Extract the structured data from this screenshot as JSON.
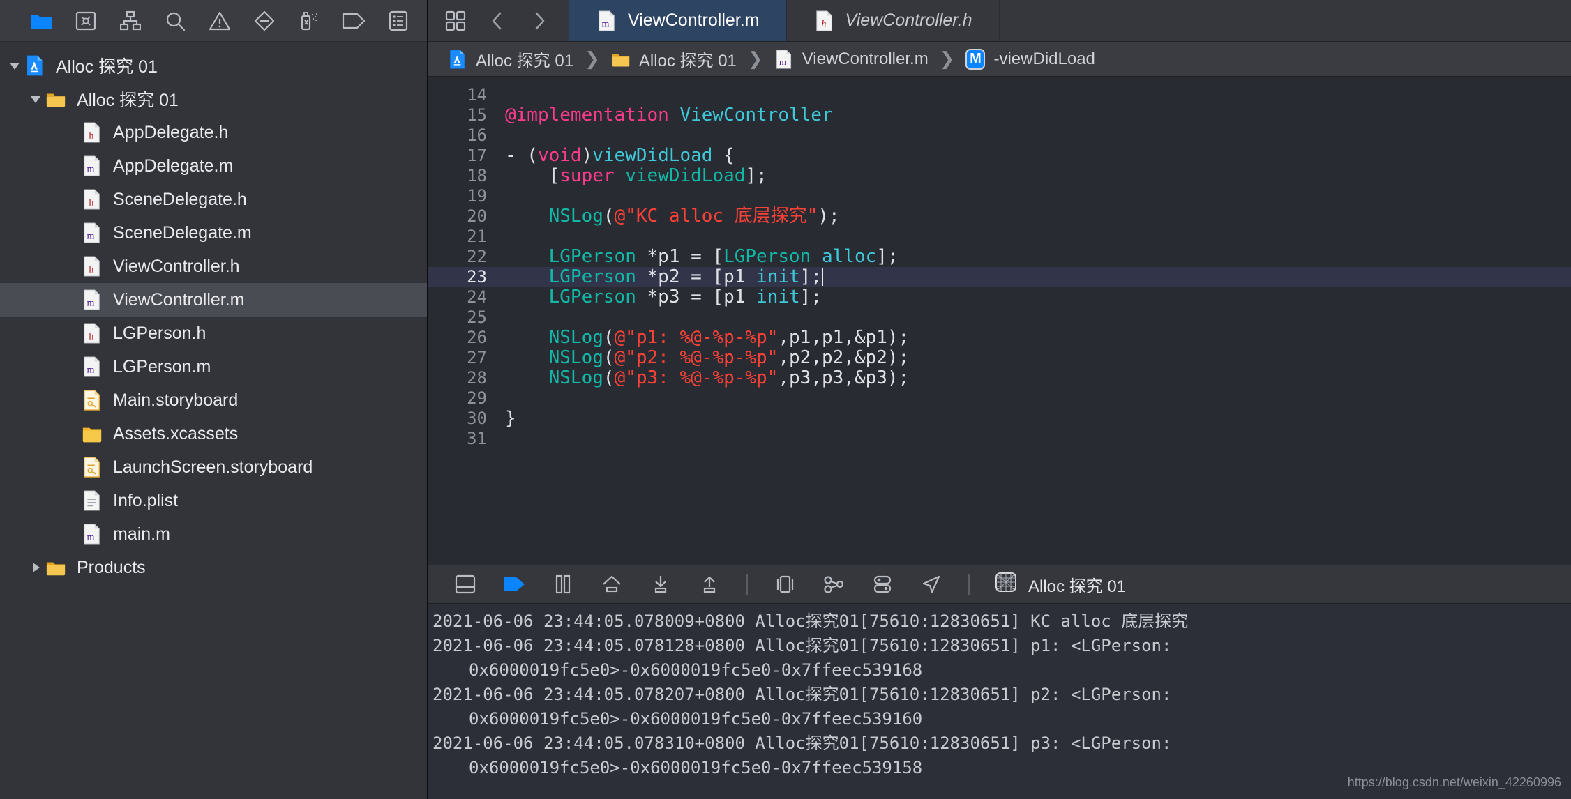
{
  "navigator": {
    "toolbar_icons": [
      {
        "name": "folder-icon",
        "label": "Project navigator"
      },
      {
        "name": "source-control-icon",
        "label": "Source control navigator"
      },
      {
        "name": "symbol-hierarchy-icon",
        "label": "Symbol navigator"
      },
      {
        "name": "search-icon",
        "label": "Find navigator"
      },
      {
        "name": "warning-triangle-icon",
        "label": "Issue navigator"
      },
      {
        "name": "test-diamond-icon",
        "label": "Test navigator"
      },
      {
        "name": "debug-spray-icon",
        "label": "Debug navigator"
      },
      {
        "name": "tag-icon",
        "label": "Breakpoint navigator"
      },
      {
        "name": "report-list-icon",
        "label": "Report navigator"
      }
    ],
    "tree": [
      {
        "label": "Alloc 探究 01",
        "icon": "xcode-project-icon",
        "depth": 0,
        "twisty": "open",
        "selected": false
      },
      {
        "label": "Alloc 探究 01",
        "icon": "folder-icon",
        "depth": 1,
        "twisty": "open",
        "selected": false
      },
      {
        "label": "AppDelegate.h",
        "icon": "header-file-icon",
        "depth": 2,
        "twisty": "none",
        "selected": false
      },
      {
        "label": "AppDelegate.m",
        "icon": "objc-file-icon",
        "depth": 2,
        "twisty": "none",
        "selected": false
      },
      {
        "label": "SceneDelegate.h",
        "icon": "header-file-icon",
        "depth": 2,
        "twisty": "none",
        "selected": false
      },
      {
        "label": "SceneDelegate.m",
        "icon": "objc-file-icon",
        "depth": 2,
        "twisty": "none",
        "selected": false
      },
      {
        "label": "ViewController.h",
        "icon": "header-file-icon",
        "depth": 2,
        "twisty": "none",
        "selected": false
      },
      {
        "label": "ViewController.m",
        "icon": "objc-file-icon",
        "depth": 2,
        "twisty": "none",
        "selected": true
      },
      {
        "label": "LGPerson.h",
        "icon": "header-file-icon",
        "depth": 2,
        "twisty": "none",
        "selected": false
      },
      {
        "label": "LGPerson.m",
        "icon": "objc-file-icon",
        "depth": 2,
        "twisty": "none",
        "selected": false
      },
      {
        "label": "Main.storyboard",
        "icon": "storyboard-file-icon",
        "depth": 2,
        "twisty": "none",
        "selected": false
      },
      {
        "label": "Assets.xcassets",
        "icon": "assets-catalog-icon",
        "depth": 2,
        "twisty": "none",
        "selected": false
      },
      {
        "label": "LaunchScreen.storyboard",
        "icon": "storyboard-file-icon",
        "depth": 2,
        "twisty": "none",
        "selected": false
      },
      {
        "label": "Info.plist",
        "icon": "plist-file-icon",
        "depth": 2,
        "twisty": "none",
        "selected": false
      },
      {
        "label": "main.m",
        "icon": "objc-file-icon",
        "depth": 2,
        "twisty": "none",
        "selected": false
      },
      {
        "label": "Products",
        "icon": "folder-icon",
        "depth": 1,
        "twisty": "closed",
        "selected": false
      }
    ]
  },
  "tabbar": {
    "grid_button": "editor-options-icon",
    "back_button": "chevron-left-icon",
    "forward_button": "chevron-right-icon",
    "tabs": [
      {
        "label": "ViewController.m",
        "icon": "objc-file-icon",
        "active": true,
        "italic": false
      },
      {
        "label": "ViewController.h",
        "icon": "header-file-icon",
        "active": false,
        "italic": true
      }
    ]
  },
  "breadcrumb": {
    "items": [
      {
        "label": "Alloc 探究 01",
        "icon": "xcode-project-icon"
      },
      {
        "label": "Alloc 探究 01",
        "icon": "folder-icon"
      },
      {
        "label": "ViewController.m",
        "icon": "objc-file-icon"
      },
      {
        "label": "-viewDidLoad",
        "icon": "method-badge-m"
      }
    ],
    "separator": "❯"
  },
  "editor": {
    "first_line_number": 14,
    "current_line": 23,
    "lines": [
      {
        "n": 14,
        "tokens": []
      },
      {
        "n": 15,
        "tokens": [
          {
            "t": "@implementation ",
            "c": "k"
          },
          {
            "t": "ViewController",
            "c": "t"
          }
        ]
      },
      {
        "n": 16,
        "tokens": []
      },
      {
        "n": 17,
        "tokens": [
          {
            "t": "- (",
            "c": "p"
          },
          {
            "t": "void",
            "c": "k"
          },
          {
            "t": ")",
            "c": "p"
          },
          {
            "t": "viewDidLoad",
            "c": "t"
          },
          {
            "t": " {",
            "c": "p"
          }
        ]
      },
      {
        "n": 18,
        "tokens": [
          {
            "t": "    [",
            "c": "p"
          },
          {
            "t": "super",
            "c": "k"
          },
          {
            "t": " ",
            "c": "p"
          },
          {
            "t": "viewDidLoad",
            "c": "cls"
          },
          {
            "t": "];",
            "c": "p"
          }
        ]
      },
      {
        "n": 19,
        "tokens": []
      },
      {
        "n": 20,
        "tokens": [
          {
            "t": "    ",
            "c": "p"
          },
          {
            "t": "NSLog",
            "c": "cls"
          },
          {
            "t": "(",
            "c": "p"
          },
          {
            "t": "@\"KC alloc 底层探究\"",
            "c": "s"
          },
          {
            "t": ");",
            "c": "p"
          }
        ]
      },
      {
        "n": 21,
        "tokens": []
      },
      {
        "n": 22,
        "tokens": [
          {
            "t": "    ",
            "c": "p"
          },
          {
            "t": "LGPerson",
            "c": "cls"
          },
          {
            "t": " *p1 = [",
            "c": "p"
          },
          {
            "t": "LGPerson",
            "c": "cls"
          },
          {
            "t": " ",
            "c": "p"
          },
          {
            "t": "alloc",
            "c": "t"
          },
          {
            "t": "];",
            "c": "p"
          }
        ]
      },
      {
        "n": 23,
        "tokens": [
          {
            "t": "    ",
            "c": "p"
          },
          {
            "t": "LGPerson",
            "c": "cls"
          },
          {
            "t": " *p2 = [p1 ",
            "c": "p"
          },
          {
            "t": "init",
            "c": "t"
          },
          {
            "t": "];",
            "c": "p"
          }
        ],
        "caret": true
      },
      {
        "n": 24,
        "tokens": [
          {
            "t": "    ",
            "c": "p"
          },
          {
            "t": "LGPerson",
            "c": "cls"
          },
          {
            "t": " *p3 = [p1 ",
            "c": "p"
          },
          {
            "t": "init",
            "c": "t"
          },
          {
            "t": "];",
            "c": "p"
          }
        ]
      },
      {
        "n": 25,
        "tokens": []
      },
      {
        "n": 26,
        "tokens": [
          {
            "t": "    ",
            "c": "p"
          },
          {
            "t": "NSLog",
            "c": "cls"
          },
          {
            "t": "(",
            "c": "p"
          },
          {
            "t": "@\"p1: %@-%p-%p\"",
            "c": "s"
          },
          {
            "t": ",p1,p1,&p1);",
            "c": "p"
          }
        ]
      },
      {
        "n": 27,
        "tokens": [
          {
            "t": "    ",
            "c": "p"
          },
          {
            "t": "NSLog",
            "c": "cls"
          },
          {
            "t": "(",
            "c": "p"
          },
          {
            "t": "@\"p2: %@-%p-%p\"",
            "c": "s"
          },
          {
            "t": ",p2,p2,&p2);",
            "c": "p"
          }
        ]
      },
      {
        "n": 28,
        "tokens": [
          {
            "t": "    ",
            "c": "p"
          },
          {
            "t": "NSLog",
            "c": "cls"
          },
          {
            "t": "(",
            "c": "p"
          },
          {
            "t": "@\"p3: %@-%p-%p\"",
            "c": "s"
          },
          {
            "t": ",p3,p3,&p3);",
            "c": "p"
          }
        ]
      },
      {
        "n": 29,
        "tokens": []
      },
      {
        "n": 30,
        "tokens": [
          {
            "t": "}",
            "c": "p"
          }
        ]
      },
      {
        "n": 31,
        "tokens": []
      }
    ]
  },
  "debugbar": {
    "icons": [
      {
        "name": "toggle-debug-area-icon"
      },
      {
        "name": "continue-execution-icon",
        "color": "#0a84ff"
      },
      {
        "name": "pause-icon"
      },
      {
        "name": "step-over-icon"
      },
      {
        "name": "step-into-icon"
      },
      {
        "name": "step-out-icon"
      },
      {
        "name": "view-hierarchy-icon"
      },
      {
        "name": "memory-graph-icon"
      },
      {
        "name": "environment-overrides-icon"
      },
      {
        "name": "simulate-location-icon"
      }
    ],
    "scheme_icon": "process-grid-icon",
    "scheme_label": "Alloc 探究 01"
  },
  "console": {
    "lines": [
      {
        "text": "2021-06-06 23:44:05.078009+0800 Alloc探究01[75610:12830651] KC alloc 底层探究",
        "indent": false
      },
      {
        "text": "2021-06-06 23:44:05.078128+0800 Alloc探究01[75610:12830651] p1: <LGPerson:",
        "indent": false
      },
      {
        "text": "0x6000019fc5e0>-0x6000019fc5e0-0x7ffeec539168",
        "indent": true
      },
      {
        "text": "2021-06-06 23:44:05.078207+0800 Alloc探究01[75610:12830651] p2: <LGPerson:",
        "indent": false
      },
      {
        "text": "0x6000019fc5e0>-0x6000019fc5e0-0x7ffeec539160",
        "indent": true
      },
      {
        "text": "2021-06-06 23:44:05.078310+0800 Alloc探究01[75610:12830651] p3: <LGPerson:",
        "indent": false
      },
      {
        "text": "0x6000019fc5e0>-0x6000019fc5e0-0x7ffeec539158",
        "indent": true
      }
    ],
    "watermark": "https://blog.csdn.net/weixin_42260996"
  },
  "colors": {
    "accent": "#0a84ff",
    "tab_active_bg": "#2d4463",
    "keyword": "#ff3b8e",
    "string": "#ff4136",
    "type": "#3ec8d8",
    "class": "#12b8a6"
  }
}
